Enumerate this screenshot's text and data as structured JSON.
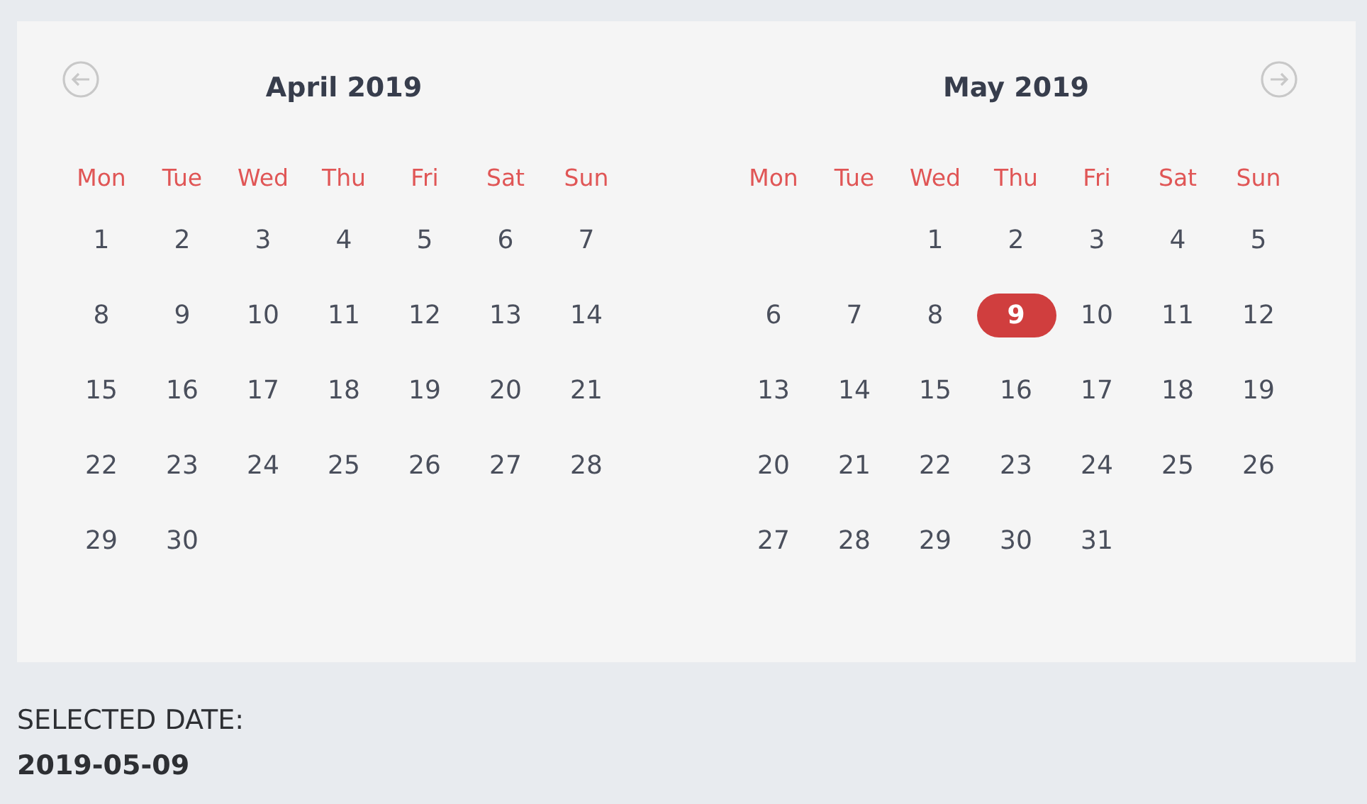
{
  "months": [
    {
      "title": "April 2019",
      "prev_arrow": true,
      "next_arrow": false,
      "weekdays": [
        "Mon",
        "Tue",
        "Wed",
        "Thu",
        "Fri",
        "Sat",
        "Sun"
      ],
      "weeks": [
        [
          {
            "kind": "day",
            "day": "1",
            "selected": false
          },
          {
            "kind": "day",
            "day": "2",
            "selected": false
          },
          {
            "kind": "day",
            "day": "3",
            "selected": false
          },
          {
            "kind": "day",
            "day": "4",
            "selected": false
          },
          {
            "kind": "day",
            "day": "5",
            "selected": false
          },
          {
            "kind": "day",
            "day": "6",
            "selected": false
          },
          {
            "kind": "day",
            "day": "7",
            "selected": false
          }
        ],
        [
          {
            "kind": "day",
            "day": "8",
            "selected": false
          },
          {
            "kind": "day",
            "day": "9",
            "selected": false
          },
          {
            "kind": "day",
            "day": "10",
            "selected": false
          },
          {
            "kind": "day",
            "day": "11",
            "selected": false
          },
          {
            "kind": "day",
            "day": "12",
            "selected": false
          },
          {
            "kind": "day",
            "day": "13",
            "selected": false
          },
          {
            "kind": "day",
            "day": "14",
            "selected": false
          }
        ],
        [
          {
            "kind": "day",
            "day": "15",
            "selected": false
          },
          {
            "kind": "day",
            "day": "16",
            "selected": false
          },
          {
            "kind": "day",
            "day": "17",
            "selected": false
          },
          {
            "kind": "day",
            "day": "18",
            "selected": false
          },
          {
            "kind": "day",
            "day": "19",
            "selected": false
          },
          {
            "kind": "day",
            "day": "20",
            "selected": false
          },
          {
            "kind": "day",
            "day": "21",
            "selected": false
          }
        ],
        [
          {
            "kind": "day",
            "day": "22",
            "selected": false
          },
          {
            "kind": "day",
            "day": "23",
            "selected": false
          },
          {
            "kind": "day",
            "day": "24",
            "selected": false
          },
          {
            "kind": "day",
            "day": "25",
            "selected": false
          },
          {
            "kind": "day",
            "day": "26",
            "selected": false
          },
          {
            "kind": "day",
            "day": "27",
            "selected": false
          },
          {
            "kind": "day",
            "day": "28",
            "selected": false
          }
        ],
        [
          {
            "kind": "day",
            "day": "29",
            "selected": false
          },
          {
            "kind": "day",
            "day": "30",
            "selected": false
          }
        ]
      ]
    },
    {
      "title": "May 2019",
      "prev_arrow": false,
      "next_arrow": true,
      "weekdays": [
        "Mon",
        "Tue",
        "Wed",
        "Thu",
        "Fri",
        "Sat",
        "Sun"
      ],
      "weeks": [
        [
          {
            "kind": "blank"
          },
          {
            "kind": "blank"
          },
          {
            "kind": "day",
            "day": "1",
            "selected": false
          },
          {
            "kind": "day",
            "day": "2",
            "selected": false
          },
          {
            "kind": "day",
            "day": "3",
            "selected": false
          },
          {
            "kind": "day",
            "day": "4",
            "selected": false
          },
          {
            "kind": "day",
            "day": "5",
            "selected": false
          }
        ],
        [
          {
            "kind": "day",
            "day": "6",
            "selected": false
          },
          {
            "kind": "day",
            "day": "7",
            "selected": false
          },
          {
            "kind": "day",
            "day": "8",
            "selected": false
          },
          {
            "kind": "day",
            "day": "9",
            "selected": true
          },
          {
            "kind": "day",
            "day": "10",
            "selected": false
          },
          {
            "kind": "day",
            "day": "11",
            "selected": false
          },
          {
            "kind": "day",
            "day": "12",
            "selected": false
          }
        ],
        [
          {
            "kind": "day",
            "day": "13",
            "selected": false
          },
          {
            "kind": "day",
            "day": "14",
            "selected": false
          },
          {
            "kind": "day",
            "day": "15",
            "selected": false
          },
          {
            "kind": "day",
            "day": "16",
            "selected": false
          },
          {
            "kind": "day",
            "day": "17",
            "selected": false
          },
          {
            "kind": "day",
            "day": "18",
            "selected": false
          },
          {
            "kind": "day",
            "day": "19",
            "selected": false
          }
        ],
        [
          {
            "kind": "day",
            "day": "20",
            "selected": false
          },
          {
            "kind": "day",
            "day": "21",
            "selected": false
          },
          {
            "kind": "day",
            "day": "22",
            "selected": false
          },
          {
            "kind": "day",
            "day": "23",
            "selected": false
          },
          {
            "kind": "day",
            "day": "24",
            "selected": false
          },
          {
            "kind": "day",
            "day": "25",
            "selected": false
          },
          {
            "kind": "day",
            "day": "26",
            "selected": false
          }
        ],
        [
          {
            "kind": "day",
            "day": "27",
            "selected": false
          },
          {
            "kind": "day",
            "day": "28",
            "selected": false
          },
          {
            "kind": "day",
            "day": "29",
            "selected": false
          },
          {
            "kind": "day",
            "day": "30",
            "selected": false
          },
          {
            "kind": "day",
            "day": "31",
            "selected": false
          }
        ]
      ]
    }
  ],
  "selected_label": "SELECTED DATE:",
  "selected_value": "2019-05-09"
}
